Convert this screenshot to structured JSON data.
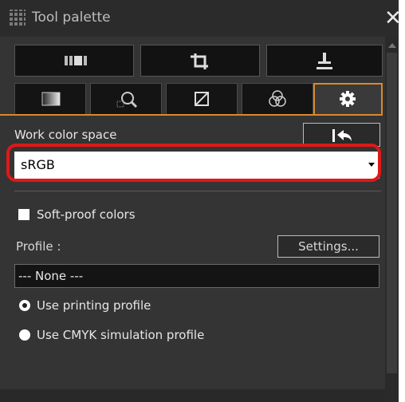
{
  "window": {
    "title": "Tool palette",
    "close_icon": "close-icon"
  },
  "toolbar": {
    "buttons": [
      {
        "icon": "filmstrip-icon"
      },
      {
        "icon": "crop-icon"
      },
      {
        "icon": "stamp-icon"
      }
    ]
  },
  "tabs": [
    {
      "icon": "image-quality-icon"
    },
    {
      "icon": "lens-correction-icon"
    },
    {
      "icon": "tone-curve-icon"
    },
    {
      "icon": "color-adjust-icon"
    },
    {
      "icon": "settings-gear-icon",
      "active": true
    }
  ],
  "work_color_space": {
    "label": "Work color space",
    "value": "sRGB",
    "reset_icon": "reset-arrow-icon"
  },
  "soft_proof": {
    "checkbox_label": "Soft-proof colors",
    "profile_label": "Profile :",
    "settings_button": "Settings...",
    "profile_value": "--- None ---",
    "options": [
      {
        "label": "Use printing profile",
        "selected": true
      },
      {
        "label": "Use CMYK simulation profile",
        "selected": false
      }
    ]
  },
  "colors": {
    "accent_orange": "#d9892a",
    "highlight_red": "#e01818",
    "background": "#343434"
  }
}
